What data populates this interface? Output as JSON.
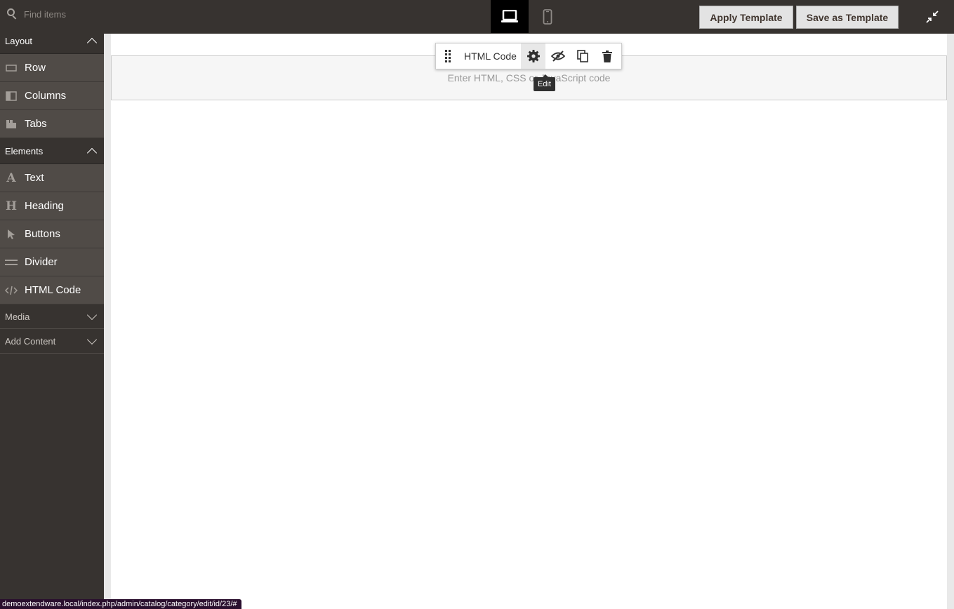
{
  "search": {
    "placeholder": "Find items"
  },
  "devices": {
    "desktop": "laptop-icon",
    "mobile": "mobile-icon"
  },
  "actions": {
    "apply_label": "Apply Template",
    "save_label": "Save as Template"
  },
  "sidebar": {
    "layout": {
      "title": "Layout",
      "items": [
        {
          "label": "Row"
        },
        {
          "label": "Columns"
        },
        {
          "label": "Tabs"
        }
      ]
    },
    "elements": {
      "title": "Elements",
      "items": [
        {
          "label": "Text"
        },
        {
          "label": "Heading"
        },
        {
          "label": "Buttons"
        },
        {
          "label": "Divider"
        },
        {
          "label": "HTML Code"
        }
      ]
    },
    "media": {
      "title": "Media"
    },
    "add_content": {
      "title": "Add Content"
    }
  },
  "stage": {
    "html_placeholder": "Enter HTML, CSS or JavaScript code",
    "toolbar": {
      "label": "HTML Code",
      "tooltip": "Edit"
    }
  },
  "status_url": "demoextendware.local/index.php/admin/catalog/category/edit/id/23/#",
  "colors": {
    "panel": "#373330",
    "item": "#504b47",
    "active_device": "#000000"
  }
}
